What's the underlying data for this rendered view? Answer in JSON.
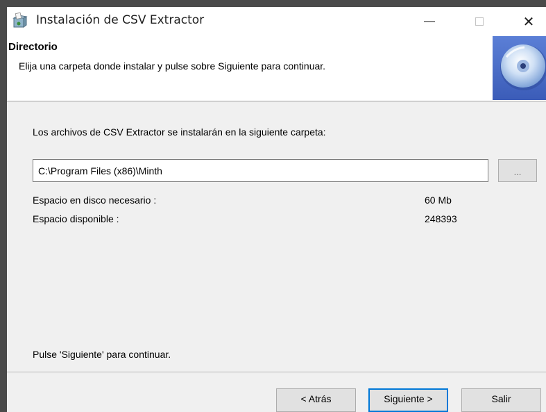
{
  "window": {
    "title": "Instalación de  CSV Extractor",
    "minimize_glyph": "—",
    "close_glyph": "✕"
  },
  "header": {
    "title": "Directorio",
    "description": "Elija una carpeta donde instalar y pulse sobre Siguiente para continuar."
  },
  "content": {
    "install_message": "Los archivos de  CSV Extractor se instalarán en la siguiente carpeta:",
    "path_value": "C:\\Program Files (x86)\\Minth",
    "browse_label": "...",
    "required_space_label": "Espacio en disco necesario :",
    "required_space_value": "60 Mb",
    "available_space_label": "Espacio disponible :",
    "available_space_value": "248393",
    "footer_message": "Pulse 'Siguiente' para continuar."
  },
  "buttons": {
    "back": "< Atrás",
    "next": "Siguiente >",
    "exit": "Salir"
  },
  "colors": {
    "focus_border": "#0078d7",
    "panel_background": "#f0f0f0",
    "header_background": "#ffffff"
  },
  "icons": {
    "app": "installer-box-icon",
    "header": "cd-disc-icon"
  }
}
